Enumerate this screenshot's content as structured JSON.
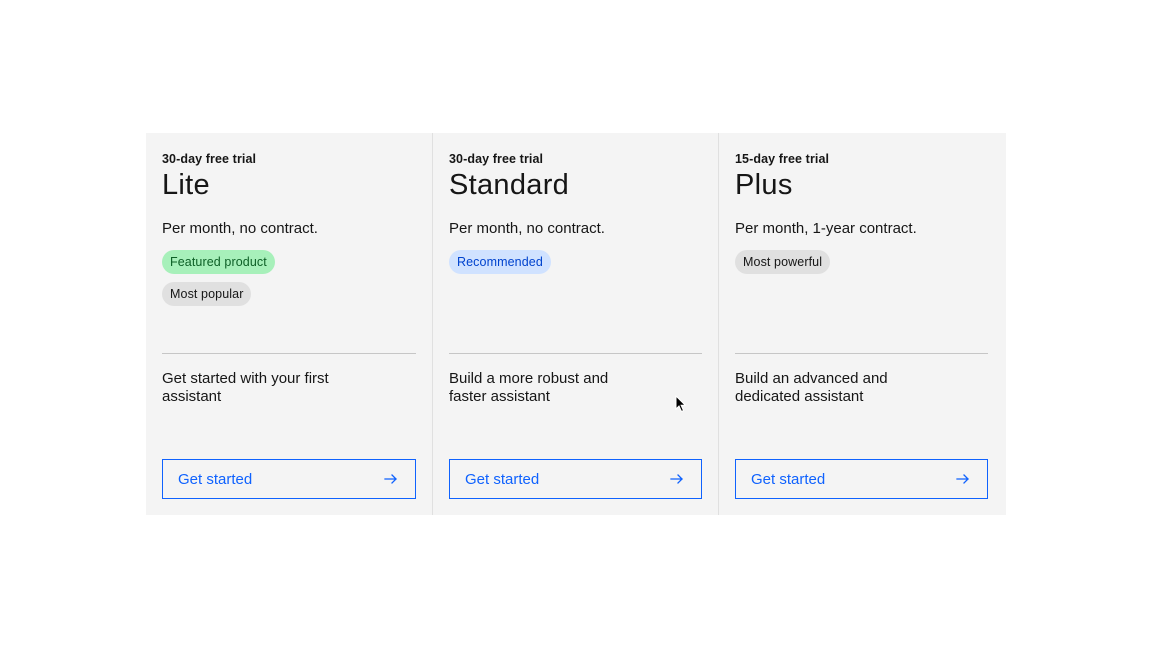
{
  "plans": [
    {
      "trial": "30-day free trial",
      "name": "Lite",
      "price_note": "Per month, no contract.",
      "tags": [
        {
          "label": "Featured product",
          "color": "green"
        },
        {
          "label": "Most popular",
          "color": "gray"
        }
      ],
      "description": "Get started with your first assistant",
      "cta_label": "Get started",
      "cta_icon": "arrow-right-icon"
    },
    {
      "trial": "30-day free trial",
      "name": "Standard",
      "price_note": "Per month, no contract.",
      "tags": [
        {
          "label": "Recommended",
          "color": "blue"
        }
      ],
      "description": "Build a more robust and faster assistant",
      "cta_label": "Get started",
      "cta_icon": "arrow-right-icon"
    },
    {
      "trial": "15-day free trial",
      "name": "Plus",
      "price_note": "Per month, 1-year contract.",
      "tags": [
        {
          "label": "Most powerful",
          "color": "gray"
        }
      ],
      "description": "Build an advanced and dedicated assistant",
      "cta_label": "Get started",
      "cta_icon": "arrow-right-icon"
    }
  ],
  "colors": {
    "accent": "#0f62fe",
    "card_background": "#f4f4f4",
    "tag_green": "#a7f0ba",
    "tag_blue": "#d0e2ff",
    "tag_gray": "#e0e0e0"
  }
}
